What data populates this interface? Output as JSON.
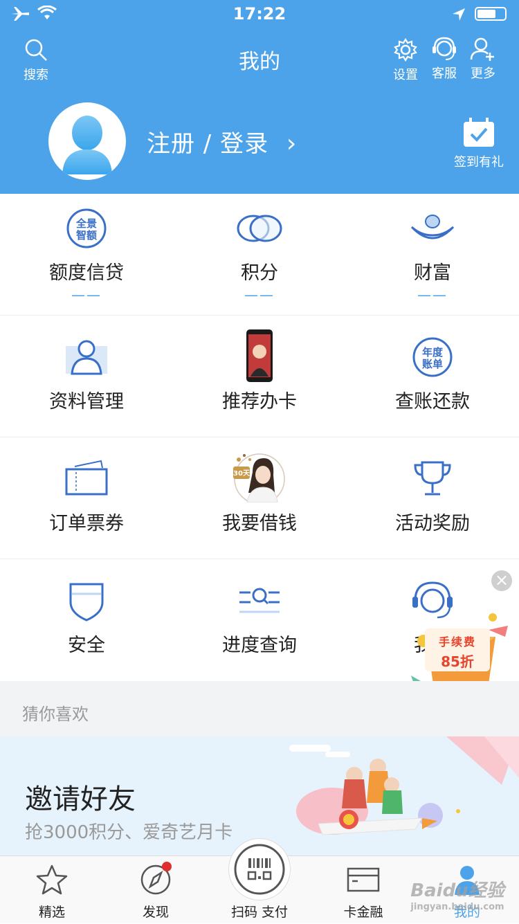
{
  "status": {
    "time": "17:22"
  },
  "header": {
    "title": "我的",
    "search_label": "搜索",
    "settings_label": "设置",
    "service_label": "客服",
    "more_label": "更多",
    "login_label": "注册 / 登录",
    "login_arrow": "›",
    "checkin_label": "签到有礼"
  },
  "grid": {
    "row1": [
      {
        "label": "额度信贷",
        "sub": "——",
        "icon": "panorama-limit-icon",
        "icon_text": [
          "全景",
          "智额"
        ]
      },
      {
        "label": "积分",
        "sub": "——",
        "icon": "points-rings-icon"
      },
      {
        "label": "财富",
        "sub": "——",
        "icon": "ingot-icon"
      }
    ],
    "row2": [
      {
        "label": "资料管理",
        "icon": "profile-icon"
      },
      {
        "label": "推荐办卡",
        "icon": "phone-image-icon"
      },
      {
        "label": "查账还款",
        "icon": "annual-bill-icon",
        "icon_text": [
          "年度",
          "账单"
        ]
      }
    ],
    "row3": [
      {
        "label": "订单票券",
        "icon": "ticket-icon"
      },
      {
        "label": "我要借钱",
        "icon": "loan-woman-icon",
        "icon_text": "30天"
      },
      {
        "label": "活动奖励",
        "icon": "trophy-icon"
      }
    ],
    "row4": [
      {
        "label": "安全",
        "icon": "shield-icon"
      },
      {
        "label": "进度查询",
        "icon": "progress-search-icon"
      },
      {
        "label": "我的",
        "icon": "headset-agent-icon"
      }
    ]
  },
  "promo": {
    "line1": "手续费",
    "line2": "85折",
    "close": "×"
  },
  "section": {
    "guess_label": "猜你喜欢"
  },
  "banner": {
    "title": "邀请好友",
    "subtitle": "抢3000积分、爱奇艺月卡"
  },
  "tabbar": {
    "tabs": [
      {
        "label": "精选",
        "icon": "star-icon"
      },
      {
        "label": "发现",
        "icon": "compass-icon"
      },
      {
        "label": "扫码 支付",
        "icon": "scan-pay-icon"
      },
      {
        "label": "卡金融",
        "icon": "card-icon"
      },
      {
        "label": "我的",
        "icon": "user-icon"
      }
    ]
  },
  "watermark": {
    "text": "Baidu经验",
    "url": "jingyan.baidu.com"
  },
  "colors": {
    "brand_blue": "#4da3ea",
    "icon_blue": "#3a6fc8",
    "accent_red": "#e8432c",
    "badge_red": "#e02d2d"
  }
}
